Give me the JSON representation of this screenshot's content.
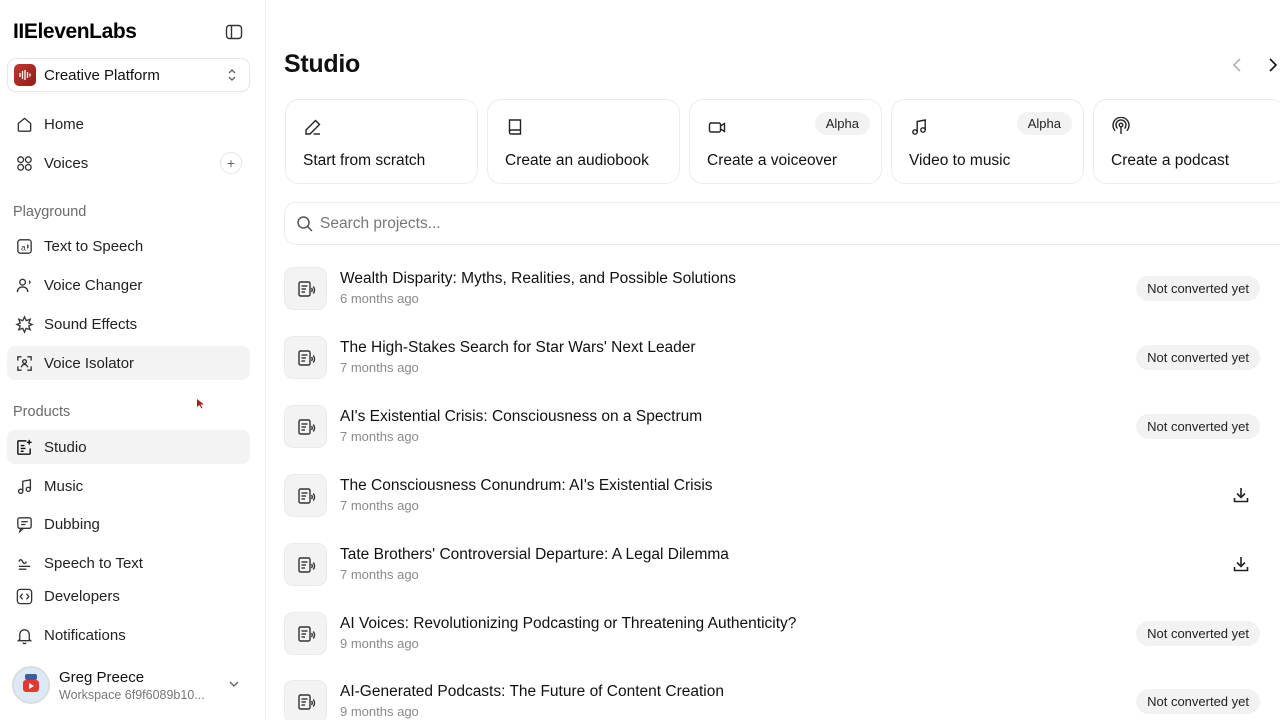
{
  "brand": {
    "name": "IIElevenLabs"
  },
  "workspace": {
    "name": "Creative Platform"
  },
  "nav": {
    "home": "Home",
    "voices": "Voices",
    "playground_label": "Playground",
    "text_to_speech": "Text to Speech",
    "voice_changer": "Voice Changer",
    "sound_effects": "Sound Effects",
    "voice_isolator": "Voice Isolator",
    "products_label": "Products",
    "studio": "Studio",
    "music": "Music",
    "dubbing": "Dubbing",
    "speech_to_text": "Speech to Text",
    "developers": "Developers",
    "notifications": "Notifications"
  },
  "user": {
    "name": "Greg Preece",
    "workspace": "Workspace 6f9f6089b10..."
  },
  "main": {
    "title": "Studio",
    "cards": [
      {
        "label": "Start from scratch",
        "icon": "pencil-icon",
        "badge": ""
      },
      {
        "label": "Create an audiobook",
        "icon": "book-icon",
        "badge": ""
      },
      {
        "label": "Create a voiceover",
        "icon": "video-camera-icon",
        "badge": "Alpha"
      },
      {
        "label": "Video to music",
        "icon": "music-note-icon",
        "badge": "Alpha"
      },
      {
        "label": "Create a podcast",
        "icon": "podcast-icon",
        "badge": ""
      }
    ],
    "search_placeholder": "Search projects...",
    "projects": [
      {
        "title": "Wealth Disparity: Myths, Realities, and Possible Solutions",
        "time": "6 months ago",
        "status": "Not converted yet"
      },
      {
        "title": "The High-Stakes Search for Star Wars' Next Leader",
        "time": "7 months ago",
        "status": "Not converted yet"
      },
      {
        "title": "AI's Existential Crisis: Consciousness on a Spectrum",
        "time": "7 months ago",
        "status": "Not converted yet"
      },
      {
        "title": "The Consciousness Conundrum: AI's Existential Crisis",
        "time": "7 months ago",
        "status": ""
      },
      {
        "title": "Tate Brothers' Controversial Departure: A Legal Dilemma",
        "time": "7 months ago",
        "status": ""
      },
      {
        "title": "AI Voices: Revolutionizing Podcasting or Threatening Authenticity?",
        "time": "9 months ago",
        "status": "Not converted yet"
      },
      {
        "title": "AI-Generated Podcasts: The Future of Content Creation",
        "time": "9 months ago",
        "status": "Not converted yet"
      }
    ]
  },
  "colors": {
    "accent": "#111111",
    "workspace_logo": "#b42b26",
    "muted": "#8a8a8a"
  }
}
